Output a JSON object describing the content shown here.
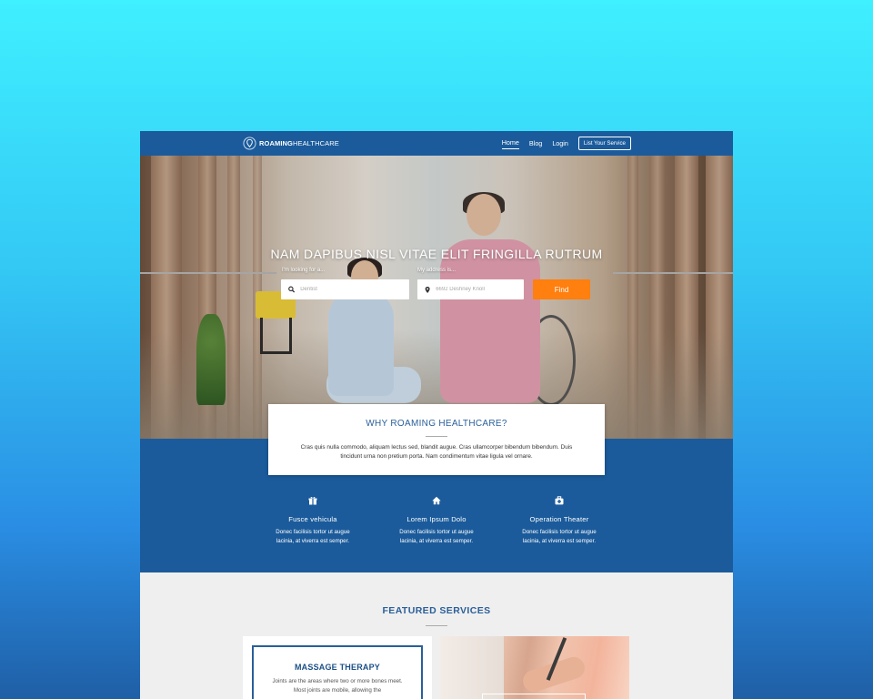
{
  "brand": {
    "name_bold": "ROAMING",
    "name_light": "HEALTHCARE",
    "icon": "location-pin-icon"
  },
  "nav": {
    "items": [
      {
        "label": "Home",
        "active": true
      },
      {
        "label": "Blog",
        "active": false
      },
      {
        "label": "Login",
        "active": false
      }
    ],
    "cta_label": "List Your Service"
  },
  "hero": {
    "title": "NAM DAPIBUS NISL VITAE ELIT FRINGILLA RUTRUM",
    "search": {
      "service_label": "I'm looking for a...",
      "service_placeholder": "Dentist",
      "address_label": "My address is...",
      "address_placeholder": "6692 Deshney Knoll",
      "find_label": "Find"
    }
  },
  "why": {
    "title": "WHY ROAMING HEALTHCARE?",
    "text": "Cras quis nulla commodo, aliquam lectus sed, blandit augue. Cras ullamcorper bibendum bibendum. Duis tincidunt urna non pretium porta. Nam condimentum vitae ligula vel ornare."
  },
  "features": [
    {
      "icon": "gift-icon",
      "title": "Fusce vehicula",
      "text": "Donec facilisis tortor ut augue lacinia, at viverra est semper."
    },
    {
      "icon": "home-icon",
      "title": "Lorem Ipsum Dolo",
      "text": "Donec facilisis tortor ut augue lacinia, at viverra est semper."
    },
    {
      "icon": "medical-kit-icon",
      "title": "Operation Theater",
      "text": "Donec facilisis tortor ut augue lacinia, at viverra est semper."
    }
  ],
  "featured": {
    "title": "FEATURED SERVICES",
    "card": {
      "title": "MASSAGE THERAPY",
      "text": "Joints are the areas where two or more bones meet. Most joints are mobile, allowing the"
    }
  },
  "colors": {
    "primary": "#1b5b9b",
    "accent": "#ff7f0f",
    "heading": "#2a5f9a"
  }
}
